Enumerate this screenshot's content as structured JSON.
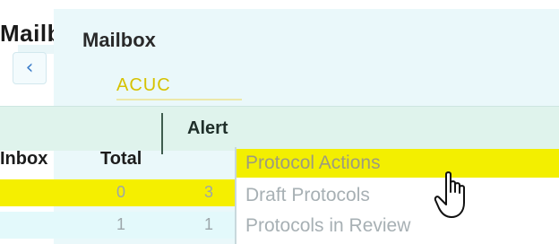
{
  "background_window": {
    "title": "Mailb",
    "back_icon": "chevron-left-icon"
  },
  "panel": {
    "title": "Mailbox",
    "accent_link": "ACUC"
  },
  "section": {
    "title": "Alert"
  },
  "table": {
    "columns": [
      "Inbox",
      "Total"
    ],
    "rows": [
      {
        "inbox": "",
        "total": "0",
        "extra": "3"
      },
      {
        "inbox": "",
        "total": "1",
        "extra": "1"
      }
    ]
  },
  "menu": {
    "items": [
      {
        "label": "Protocol Actions",
        "active": true
      },
      {
        "label": "Draft Protocols",
        "active": false
      },
      {
        "label": "Protocols in Review",
        "active": false
      }
    ]
  },
  "colors": {
    "highlight": "#f3ef00",
    "panel_bg": "#eaf8fa",
    "accent": "#d6c200"
  },
  "cursor_icon": "hand-pointer-icon"
}
